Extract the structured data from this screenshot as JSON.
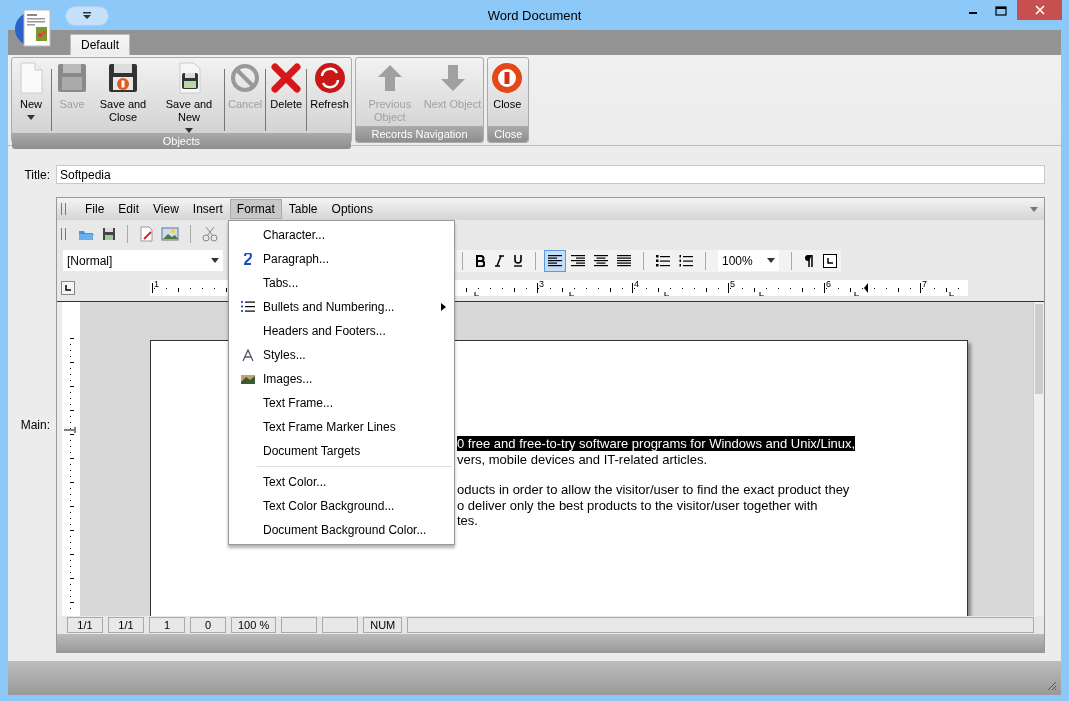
{
  "window": {
    "title": "Word Document"
  },
  "ribbon_tabs": [
    {
      "label": "Default",
      "selected": true
    }
  ],
  "ribbon_groups": [
    {
      "label": "Objects",
      "buttons": [
        {
          "kind": "new",
          "label": "New",
          "disabled": false,
          "dropdown": true
        },
        {
          "kind": "save",
          "label": "Save",
          "disabled": true,
          "dropdown": false
        },
        {
          "kind": "save-close",
          "label": "Save and Close",
          "disabled": false,
          "dropdown": false
        },
        {
          "kind": "save-new",
          "label": "Save and New",
          "disabled": false,
          "dropdown": true
        },
        {
          "kind": "cancel",
          "label": "Cancel",
          "disabled": true,
          "dropdown": false
        },
        {
          "kind": "delete",
          "label": "Delete",
          "disabled": false,
          "dropdown": false
        },
        {
          "kind": "refresh",
          "label": "Refresh",
          "disabled": false,
          "dropdown": false
        }
      ]
    },
    {
      "label": "Records Navigation",
      "buttons": [
        {
          "kind": "up",
          "label": "Previous Object",
          "disabled": true,
          "dropdown": false
        },
        {
          "kind": "down",
          "label": "Next Object",
          "disabled": true,
          "dropdown": false
        }
      ]
    },
    {
      "label": "Close",
      "buttons": [
        {
          "kind": "close",
          "label": "Close",
          "disabled": false,
          "dropdown": false
        }
      ]
    }
  ],
  "title_field": {
    "label": "Title:",
    "value": "Softpedia"
  },
  "main_label": "Main:",
  "menu_bar": [
    {
      "label": "File",
      "selected": false
    },
    {
      "label": "Edit",
      "selected": false
    },
    {
      "label": "View",
      "selected": false
    },
    {
      "label": "Insert",
      "selected": false
    },
    {
      "label": "Format",
      "selected": true
    },
    {
      "label": "Table",
      "selected": false
    },
    {
      "label": "Options",
      "selected": false
    }
  ],
  "style_combo": {
    "value": "[Normal]"
  },
  "alignment": [
    {
      "kind": "left",
      "selected": true
    },
    {
      "kind": "right",
      "selected": false
    },
    {
      "kind": "center",
      "selected": false
    },
    {
      "kind": "justify",
      "selected": false
    }
  ],
  "zoom_combo": {
    "value": "100%"
  },
  "ruler_numbers": [
    "1",
    "3",
    "4",
    "5",
    "6",
    "7"
  ],
  "format_menu": [
    {
      "kind": "plain",
      "label": "Character...",
      "submenu": false
    },
    {
      "kind": "paragraph",
      "label": "Paragraph...",
      "submenu": false
    },
    {
      "kind": "plain",
      "label": "Tabs...",
      "submenu": false
    },
    {
      "kind": "bullets",
      "label": "Bullets and Numbering...",
      "submenu": true
    },
    {
      "kind": "plain",
      "label": "Headers and Footers...",
      "submenu": false
    },
    {
      "kind": "styles",
      "label": "Styles...",
      "submenu": false
    },
    {
      "kind": "images",
      "label": "Images...",
      "submenu": false
    },
    {
      "kind": "plain",
      "label": "Text Frame...",
      "submenu": false
    },
    {
      "kind": "plain",
      "label": "Text Frame Marker Lines",
      "submenu": false
    },
    {
      "kind": "plain",
      "label": "Document Targets",
      "submenu": false
    },
    {
      "kind": "separator"
    },
    {
      "kind": "plain",
      "label": "Text Color...",
      "submenu": false
    },
    {
      "kind": "plain",
      "label": "Text Color Background...",
      "submenu": false
    },
    {
      "kind": "plain",
      "label": "Document Background Color...",
      "submenu": false
    }
  ],
  "document_paragraphs": [
    {
      "lines": [
        {
          "text": "0 free and free-to-try software programs for Windows and Unix/Linux,",
          "selected": true
        },
        {
          "text": "vers, mobile devices and IT-related articles.",
          "selected": false
        }
      ]
    },
    {
      "lines": [
        {
          "text": "oducts in order to allow the visitor/user to find the exact product they",
          "selected": false
        },
        {
          "text": "o deliver only the best products to the visitor/user together with",
          "selected": false
        },
        {
          "text": "tes.",
          "selected": false
        }
      ]
    }
  ],
  "status_cells": [
    {
      "kind": "text",
      "text": "1/1"
    },
    {
      "kind": "text",
      "text": "1/1"
    },
    {
      "kind": "text",
      "text": "1"
    },
    {
      "kind": "text",
      "text": "0"
    },
    {
      "kind": "text",
      "text": "100 %"
    },
    {
      "kind": "empty"
    },
    {
      "kind": "empty"
    },
    {
      "kind": "text",
      "text": "NUM"
    },
    {
      "kind": "wide"
    }
  ]
}
